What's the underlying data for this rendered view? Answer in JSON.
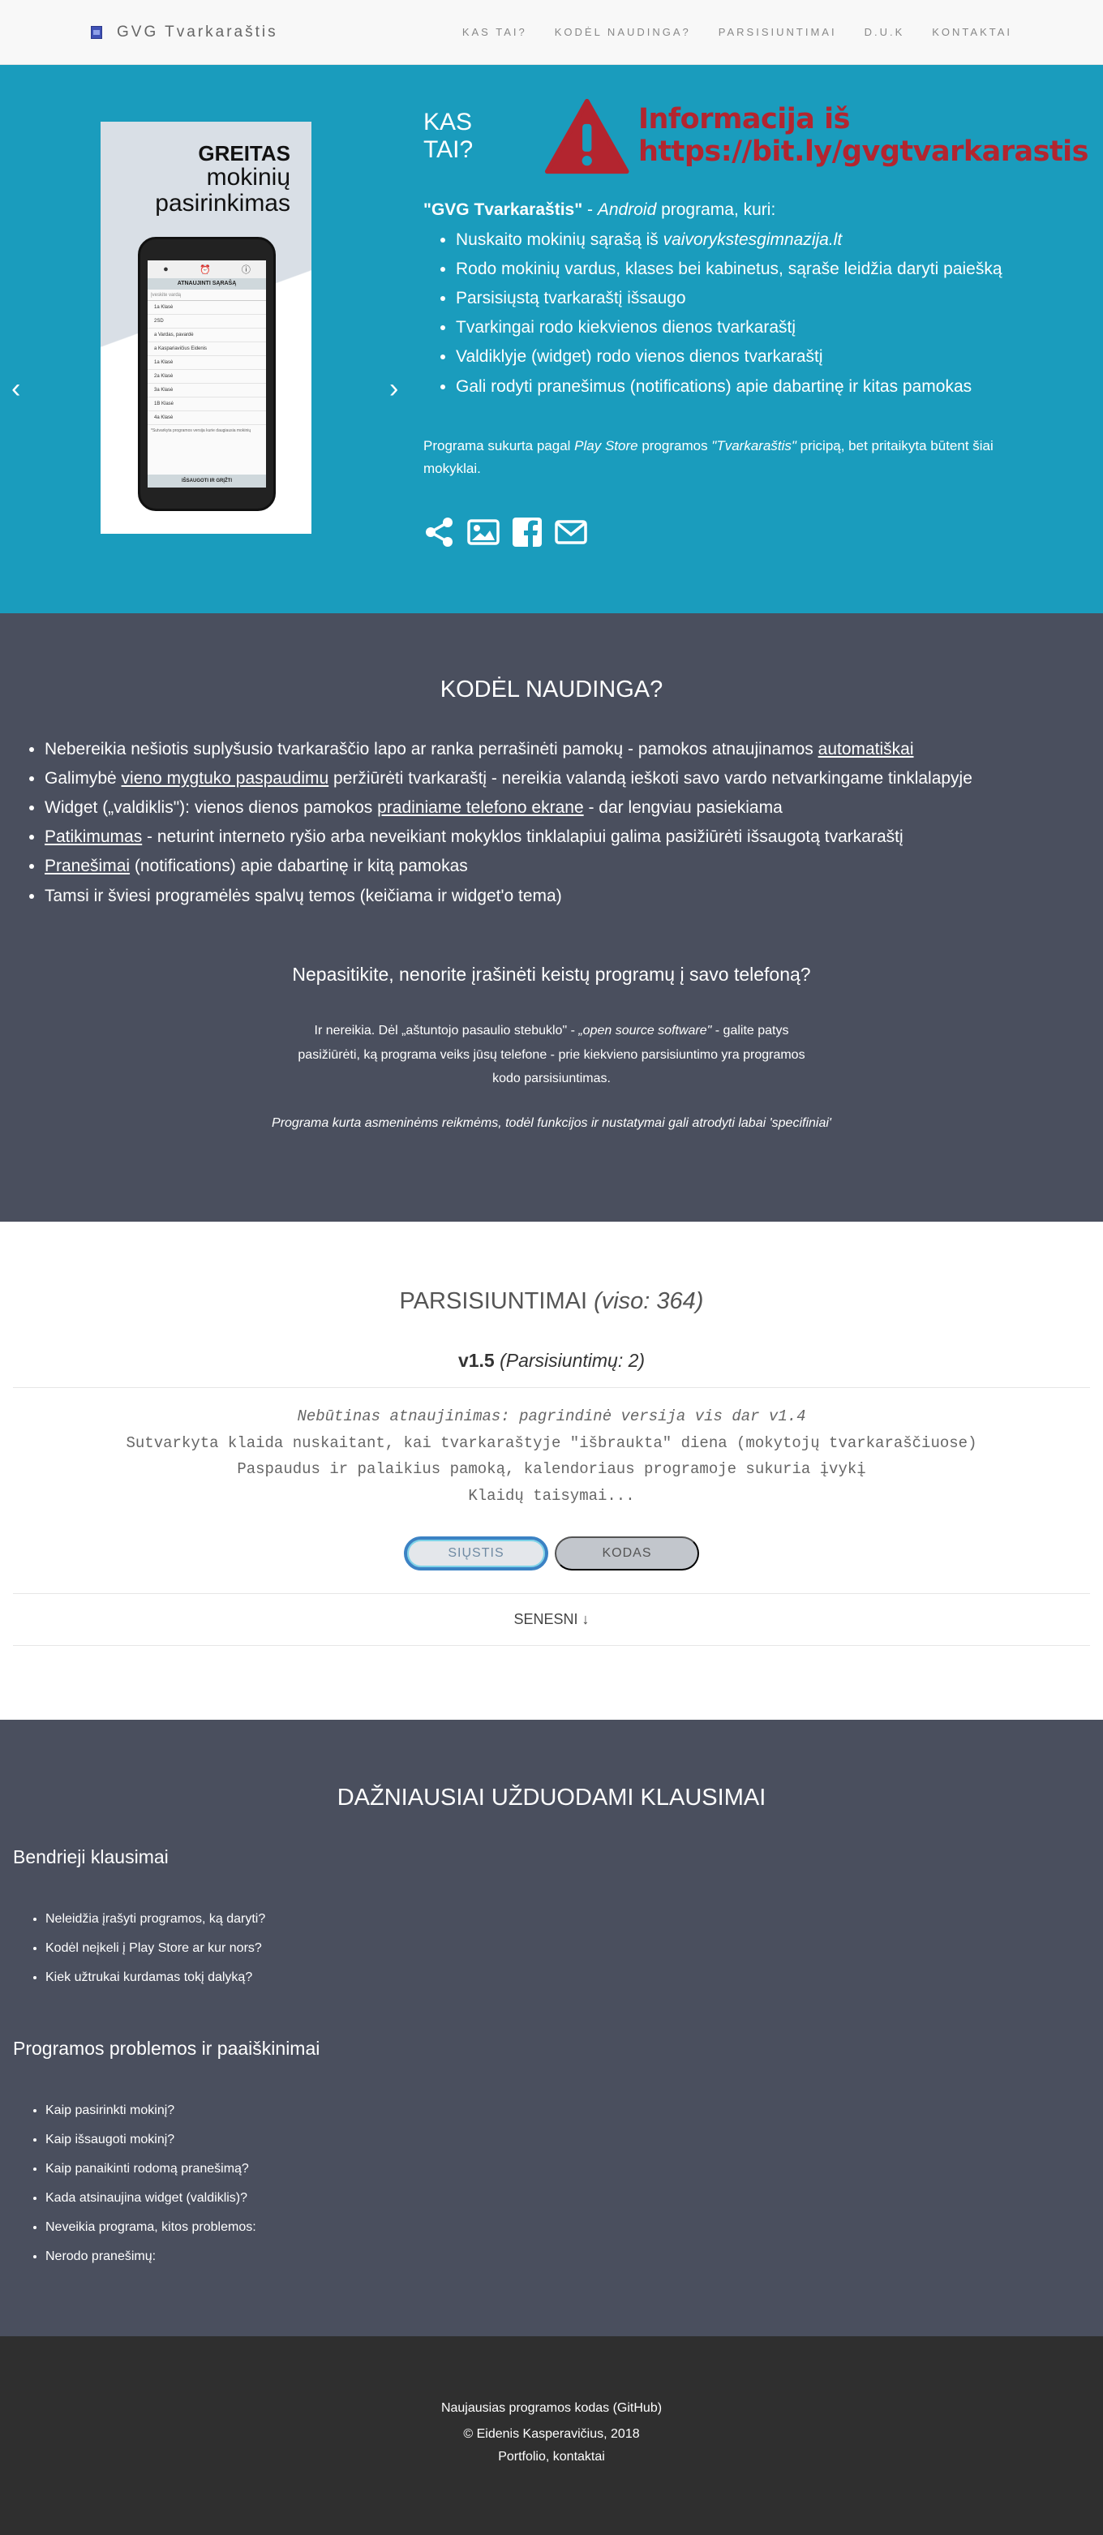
{
  "nav": {
    "brand": "GVG Tvarkaraštis",
    "links": [
      "KAS TAI?",
      "KODĖL NAUDINGA?",
      "PARSISIUNTIMAI",
      "D.U.K",
      "KONTAKTAI"
    ]
  },
  "hero": {
    "arrow_left": "‹",
    "arrow_right": "›",
    "card": {
      "title_bold": "GREITAS",
      "title_line2": "mokinių",
      "title_line3": "pasirinkimas",
      "screen_header": "ATNAUJINTI SĄRAŠĄ",
      "screen_search": "Įveskite vardą",
      "screen_rows": [
        "1a Klasė",
        "2SD",
        "a Vardas, pavardė",
        "a Kaspariavičius Eidenis",
        "1a Klasė",
        "2a Klasė",
        "3a Klasė",
        "1B Klasė",
        "4a Klasė"
      ],
      "screen_note": "*Sutvarkyta programos versija kurie daugiausia mokinių",
      "screen_button": "IŠSAUGOTI IR GRĮŽTI"
    },
    "heading": "KAS TAI?",
    "warning_line1": "Informacija iš",
    "warning_line2": "https://bit.ly/gvgtvarkarastis",
    "intro_bold": "\"GVG Tvarkaraštis\"",
    "intro_mid": " - ",
    "intro_italic": "Android",
    "intro_end": " programa, kuri:",
    "features": [
      {
        "text": "Nuskaito mokinių sąrašą iš ",
        "italic": "vaivorykstesgimnazija.lt"
      },
      {
        "text": "Rodo mokinių vardus, klases bei kabinetus, sąraše leidžia daryti paiešką",
        "italic": ""
      },
      {
        "text": "Parsisiųstą tvarkaraštį išsaugo",
        "italic": ""
      },
      {
        "text": "Tvarkingai rodo kiekvienos dienos tvarkaraštį",
        "italic": ""
      },
      {
        "text": "Valdiklyje (widget) rodo vienos dienos tvarkaraštį",
        "italic": ""
      },
      {
        "text": "Gali rodyti pranešimus (notifications) apie dabartinę ir kitas pamokas",
        "italic": ""
      }
    ],
    "note_a": "Programa sukurta pagal ",
    "note_b": "Play Store",
    "note_c": " programos ",
    "note_d": "\"Tvarkaraštis\"",
    "note_e": " pricipą, bet pritaikyta būtent šiai mokyklai."
  },
  "kodel": {
    "title": "KODĖL NAUDINGA?",
    "items": [
      {
        "before": "Nebereikia nešiotis suplyšusio tvarkaraščio lapo ar ranka perrašinėti pamokų - pamokos atnaujinamos ",
        "link": "automatiškai",
        "after": ""
      },
      {
        "before": "Galimybė ",
        "link": "vieno mygtuko paspaudimu",
        "after": " peržiūrėti tvarkaraštį - nereikia valandą ieškoti savo vardo netvarkingame tinklalapyje"
      },
      {
        "before": "Widget („valdiklis\"): vienos dienos pamokos ",
        "link": "pradiniame telefono ekrane",
        "after": " - dar lengviau pasiekiama"
      },
      {
        "before": "",
        "link": "Patikimumas",
        "after": " - neturint interneto ryšio arba neveikiant mokyklos tinklalapiui galima pasižiūrėti išsaugotą tvarkaraštį"
      },
      {
        "before": "",
        "link": "Pranešimai",
        "after": " (notifications) apie dabartinę ir kitą pamokas"
      },
      {
        "before": "Tamsi ir šviesi programėlės spalvų temos (keičiama ir widget'o tema)",
        "link": "",
        "after": ""
      }
    ],
    "subquestion": "Nepasitikite, nenorite įrašinėti keistų programų į savo telefoną?",
    "para_a": "Ir nereikia. Dėl „aštuntojo pasaulio stebuklo\" - ",
    "para_b": "„open source software\"",
    "para_c": " - galite patys pasižiūrėti, ką programa veiks jūsų telefone - prie kiekvieno parsisiuntimo yra programos kodo parsisiuntimas.",
    "italic_note": "Programa kurta asmeninėms reikmėms, todėl funkcijos ir nustatymai gali atrodyti labai 'specifiniai'"
  },
  "parsi": {
    "title": "PARSISIUNTIMAI",
    "title_count": "(viso: 364)",
    "version": "v1.5",
    "downloads": "(Parsisiuntimų: 2)",
    "changes": [
      "Nebūtinas atnaujinimas: pagrindinė versija vis dar v1.4",
      "Sutvarkyta klaida nuskaitant, kai tvarkaraštyje \"išbraukta\" diena (mokytojų tvarkaraščiuose)",
      "Paspaudus ir palaikius pamoką, kalendoriaus programoje sukuria įvykį",
      "Klaidų taisymai..."
    ],
    "download_button": "SIŲSTIS",
    "code_button": "KODAS",
    "older": "SENESNI ↓"
  },
  "faq": {
    "title": "DAŽNIAUSIAI UŽDUODAMI KLAUSIMAI",
    "general_heading": "Bendrieji klausimai",
    "general": [
      "Neleidžia įrašyti programos, ką daryti?",
      "Kodėl neįkeli į Play Store ar kur nors?",
      "Kiek užtrukai kurdamas tokį dalyką?"
    ],
    "problems_heading": "Programos problemos ir paaiškinimai",
    "problems": [
      "Kaip pasirinkti mokinį?",
      "Kaip išsaugoti mokinį?",
      "Kaip panaikinti rodomą pranešimą?",
      "Kada atsinaujina widget (valdiklis)?",
      "Neveikia programa, kitos problemos:",
      "Nerodo pranešimų:"
    ]
  },
  "footer": {
    "code_link": "Naujausias programos kodas (GitHub)",
    "copyright": "© Eidenis Kasperavičius, 2018",
    "portfolio": "Portfolio, kontaktai"
  },
  "colors": {
    "hero_bg": "#1a9cbd",
    "section_dark": "#4a4f5e",
    "warning": "#b3252f",
    "footer_bg": "#2f2f2f"
  },
  "icons": [
    "share-icon",
    "image-icon",
    "facebook-icon",
    "mail-icon",
    "warning-icon"
  ]
}
